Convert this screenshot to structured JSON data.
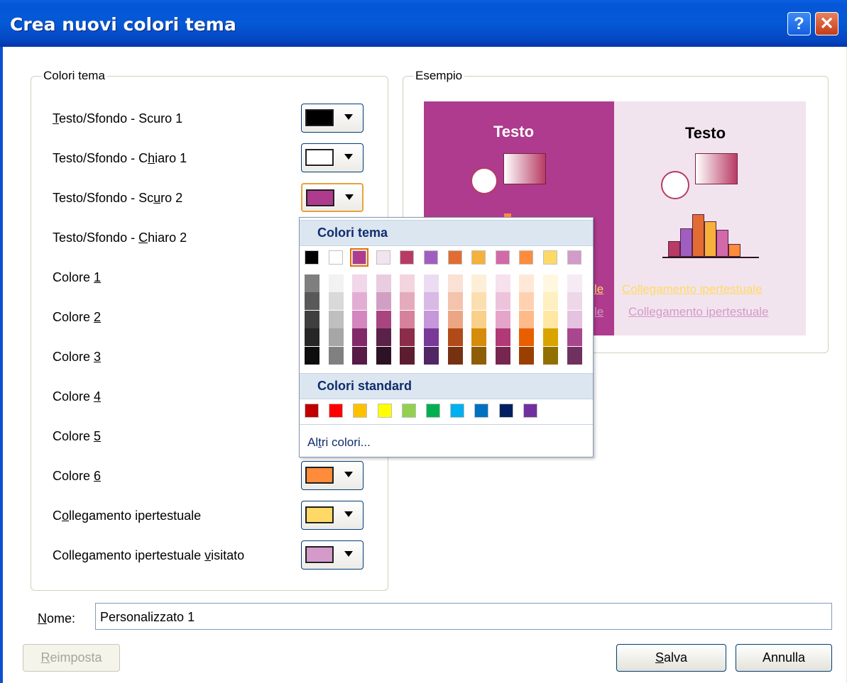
{
  "window": {
    "title": "Crea nuovi colori tema",
    "help_glyph": "?",
    "close_glyph": "✕"
  },
  "theme_colors_group": {
    "label": "Colori tema"
  },
  "example_group": {
    "label": "Esempio"
  },
  "rows": [
    {
      "label_pre": "",
      "accel": "T",
      "label_post": "esto/Sfondo - Scuro 1",
      "color": "#000000"
    },
    {
      "label_pre": "Testo/Sfondo - C",
      "accel": "h",
      "label_post": "iaro 1",
      "color": "#FFFFFF"
    },
    {
      "label_pre": "Testo/Sfondo - Sc",
      "accel": "u",
      "label_post": "ro 2",
      "color": "#AE3B8E"
    },
    {
      "label_pre": "Testo/Sfondo - ",
      "accel": "C",
      "label_post": "hiaro 2",
      "color": "#F2E4EF"
    },
    {
      "label_pre": "Colore ",
      "accel": "1",
      "label_post": "",
      "color": "#B83B64"
    },
    {
      "label_pre": "Colore ",
      "accel": "2",
      "label_post": "",
      "color": "#A05FC0"
    },
    {
      "label_pre": "Colore ",
      "accel": "3",
      "label_post": "",
      "color": "#E36C33"
    },
    {
      "label_pre": "Colore ",
      "accel": "4",
      "label_post": "",
      "color": "#F7B13A"
    },
    {
      "label_pre": "Colore ",
      "accel": "5",
      "label_post": "",
      "color": "#D269A8"
    },
    {
      "label_pre": "Colore ",
      "accel": "6",
      "label_post": "",
      "color": "#FF8C3A"
    },
    {
      "label_pre": "C",
      "accel": "o",
      "label_post": "llegamento ipertestuale",
      "color": "#FFD966"
    },
    {
      "label_pre": "Collegamento ipertestuale ",
      "accel": "v",
      "label_post": "isitato",
      "color": "#D49AC9"
    }
  ],
  "preview": {
    "left_title": "Testo",
    "right_title": "Testo",
    "link_text": "Collegamento ipertestuale",
    "visited_link_text": "Collegamento ipertestuale",
    "left_link_fragment": "le",
    "left_visited_fragment": "le",
    "link_color": "#FFD966",
    "visited_color": "#D49AC9"
  },
  "dropdown": {
    "theme_header": "Colori tema",
    "standard_header": "Colori standard",
    "more_colors_pre": "Al",
    "more_colors_accel": "t",
    "more_colors_post": "ri colori...",
    "theme_row": [
      "#000000",
      "#FFFFFF",
      "#AE3B8E",
      "#F2E4EF",
      "#B83B64",
      "#A05FC0",
      "#E36C33",
      "#F7B13A",
      "#D269A8",
      "#FF8C3A",
      "#FFD966",
      "#D49AC9"
    ],
    "shade_columns": [
      [
        "#7F7F7F",
        "#595959",
        "#3F3F3F",
        "#262626",
        "#0D0D0D"
      ],
      [
        "#F2F2F2",
        "#D9D9D9",
        "#BFBFBF",
        "#A6A6A6",
        "#808080"
      ],
      [
        "#F1D7EA",
        "#E2AED4",
        "#D386BF",
        "#82296A",
        "#571B46"
      ],
      [
        "#E9CCE0",
        "#D19FC3",
        "#A8457F",
        "#5A2248",
        "#2D1124"
      ],
      [
        "#F2D5DE",
        "#E4ABBD",
        "#D6829C",
        "#8A2C4A",
        "#5C1D31"
      ],
      [
        "#ECDCF2",
        "#D9B9E5",
        "#C697D9",
        "#793A97",
        "#502665"
      ],
      [
        "#F9E1D5",
        "#F3C3AC",
        "#ECA684",
        "#B14A19",
        "#763111"
      ],
      [
        "#FDEFD7",
        "#FBDFB0",
        "#F9D089",
        "#D58C0A",
        "#8E5D06"
      ],
      [
        "#F6E1ED",
        "#EDC3DC",
        "#E5A5CB",
        "#B23978",
        "#772650"
      ],
      [
        "#FFE8D8",
        "#FFD1B0",
        "#FFBA89",
        "#E95F00",
        "#9B3F00"
      ],
      [
        "#FFF7E0",
        "#FFF0C1",
        "#FFE8A3",
        "#D9A400",
        "#917000"
      ],
      [
        "#F6EBF4",
        "#EED7E9",
        "#E5C2DF",
        "#A8478F",
        "#703060"
      ]
    ],
    "standard_row": [
      "#C00000",
      "#FF0000",
      "#FFC000",
      "#FFFF00",
      "#92D050",
      "#00B050",
      "#00B0F0",
      "#0070C0",
      "#002060",
      "#7030A0"
    ]
  },
  "name_field": {
    "label_pre": "",
    "accel": "N",
    "label_post": "ome:",
    "value": "Personalizzato 1"
  },
  "buttons": {
    "reset": {
      "accel": "R",
      "post": "eimposta"
    },
    "save": {
      "accel": "S",
      "post": "alva"
    },
    "cancel": {
      "text": "Annulla"
    }
  }
}
